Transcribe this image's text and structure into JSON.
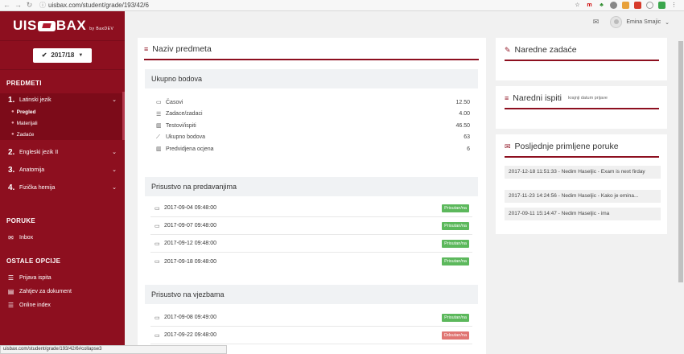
{
  "browser": {
    "url": "uisbax.com/student/grade/193/42/6",
    "status_url": "uisbax.com/student/grade/193/42/6#collapse3"
  },
  "logo": {
    "text_left": "UIS",
    "text_right": "BAX",
    "by": "by BaxDEV"
  },
  "year": {
    "label": "2017/18"
  },
  "sidebar": {
    "predmeti_title": "PREDMETI",
    "subjects": [
      {
        "num": "1.",
        "name": "Latinski jezik"
      },
      {
        "num": "2.",
        "name": "Engleski jezik II"
      },
      {
        "num": "3.",
        "name": "Anatomija"
      },
      {
        "num": "4.",
        "name": "Fizička hemija"
      }
    ],
    "sublinks": [
      "Pregled",
      "Materijali",
      "Zadaće"
    ],
    "poruke_title": "PORUKE",
    "inbox": "Inbox",
    "ostale_title": "OSTALE OPCIJE",
    "options": [
      "Prijava ispita",
      "Zahtjev za dokument",
      "Online index"
    ]
  },
  "header": {
    "user_name": "Emina Smajic"
  },
  "main": {
    "title": "Naziv predmeta",
    "points": {
      "title": "Ukupno bodova",
      "rows": [
        {
          "label": "Časovi",
          "value": "12.50"
        },
        {
          "label": "Zadace/zadaci",
          "value": "4.00"
        },
        {
          "label": "Testovi/ispiti",
          "value": "46.50"
        },
        {
          "label": "Ukupno bodova",
          "value": "63"
        },
        {
          "label": "Predvidjena ocjena",
          "value": "6"
        }
      ]
    },
    "lectures": {
      "title": "Prisustvo na predavanjima",
      "rows": [
        {
          "date": "2017-09-04 09:48:00",
          "status": "Prisutan/na"
        },
        {
          "date": "2017-09-07 09:48:00",
          "status": "Prisutan/na"
        },
        {
          "date": "2017-09-12 09:48:00",
          "status": "Prisutan/na"
        },
        {
          "date": "2017-09-18 09:48:00",
          "status": "Prisutan/na"
        }
      ]
    },
    "exercises": {
      "title": "Prisustvo na vjezbama",
      "rows": [
        {
          "date": "2017-09-08 09:49:00",
          "status": "Prisutan/na"
        },
        {
          "date": "2017-09-22 09:48:00",
          "status": "Odsutan/na"
        }
      ]
    }
  },
  "right": {
    "tasks_title": "Naredne zadaće",
    "exams_title": "Naredni ispiti",
    "exams_sub": "krajnji datum prijave",
    "messages_title": "Posljednje primljene poruke",
    "messages": [
      "2017-12-18 11:51:33 - Nedim Haseljic - Exam is next firday",
      "2017-11-23 14:24:56 - Nedim Haseljic - Kako je emina...",
      "2017-09-11 15:14:47 - Nedim Haseljic - ima"
    ]
  }
}
